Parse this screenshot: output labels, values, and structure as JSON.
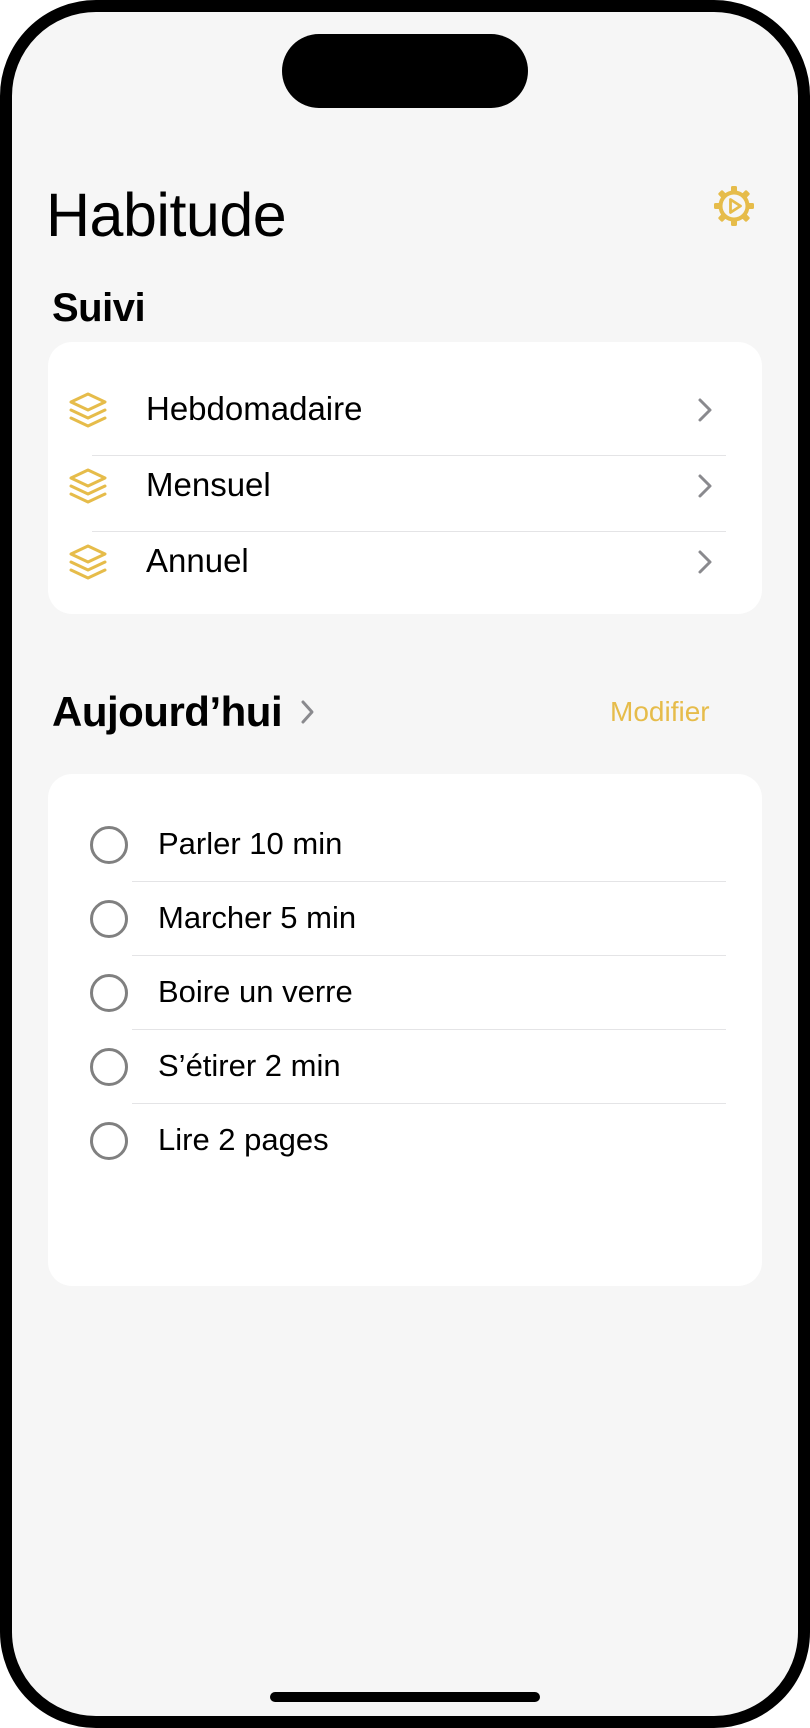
{
  "app": {
    "title": "Habitude",
    "accent_color": "#e6bc4a",
    "settings_icon": "gear-play-icon"
  },
  "suivi": {
    "title": "Suivi",
    "item_icon": "stack-layers-icon",
    "items": [
      {
        "label": "Hebdomadaire"
      },
      {
        "label": "Mensuel"
      },
      {
        "label": "Annuel"
      }
    ]
  },
  "today": {
    "title": "Aujourd’hui",
    "modify_label": "Modifier",
    "tasks": [
      {
        "label": "Parler 10 min",
        "done": false
      },
      {
        "label": "Marcher 5 min",
        "done": false
      },
      {
        "label": "Boire un verre",
        "done": false
      },
      {
        "label": "S’étirer 2 min",
        "done": false
      },
      {
        "label": "Lire 2 pages",
        "done": false
      }
    ]
  }
}
